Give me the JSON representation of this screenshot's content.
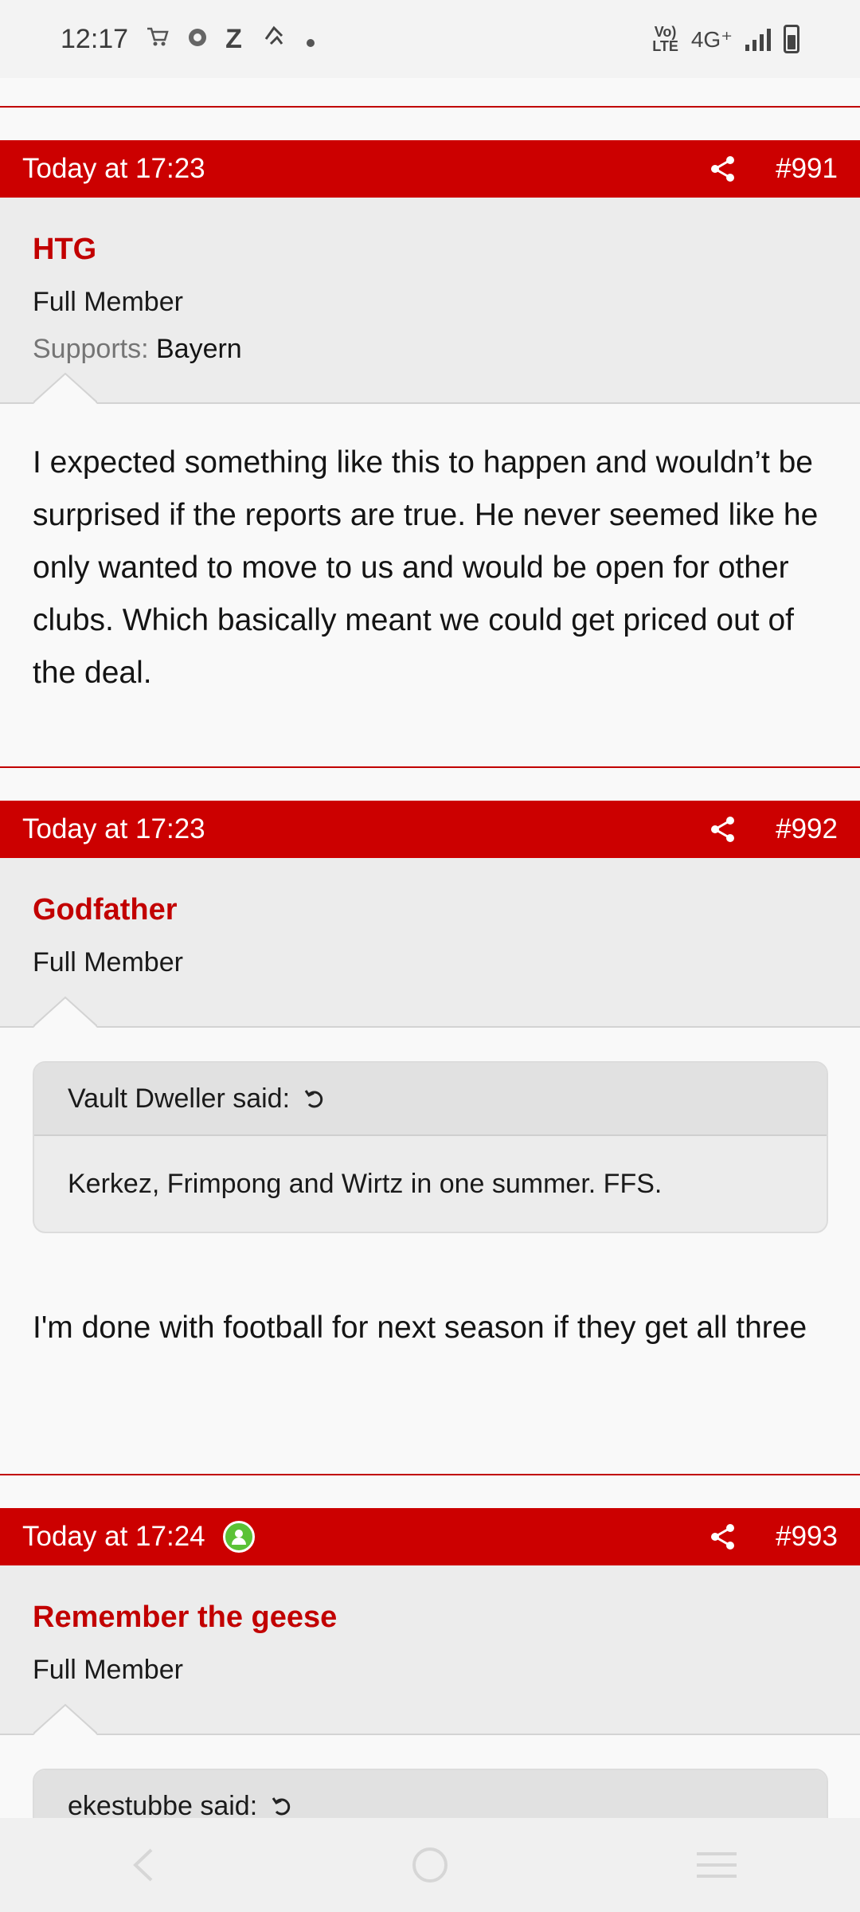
{
  "status_bar": {
    "time": "12:17",
    "network": "4G⁺",
    "volte": "VoLTE",
    "icons": [
      "cart-icon",
      "app-icon",
      "z-icon",
      "sync-icon",
      "dot-icon",
      "signal-icon",
      "battery-icon"
    ]
  },
  "posts": [
    {
      "date": "Today at 17:23",
      "number": "#991",
      "username": "HTG",
      "role": "Full Member",
      "supports_label": "Supports:",
      "supports_value": "Bayern",
      "text": "I expected something like this to happen and wouldn’t be surprised if the reports are true. He never seemed like he only wanted to move to us and would be open for other clubs. Which basically meant we could get priced out of the deal."
    },
    {
      "date": "Today at 17:23",
      "number": "#992",
      "username": "Godfather",
      "role": "Full Member",
      "quote_author": "Vault Dweller said:",
      "quote_text": "Kerkez, Frimpong and Wirtz in one summer. FFS.",
      "text": "I'm done with football for next season if they get all three"
    },
    {
      "date": "Today at 17:24",
      "number": "#993",
      "username": "Remember the geese",
      "role": "Full Member",
      "quote_author": "ekestubbe said:"
    }
  ],
  "colors": {
    "header_red": "#cc0000",
    "username_red": "#c20000",
    "online_green": "#5bc236"
  }
}
